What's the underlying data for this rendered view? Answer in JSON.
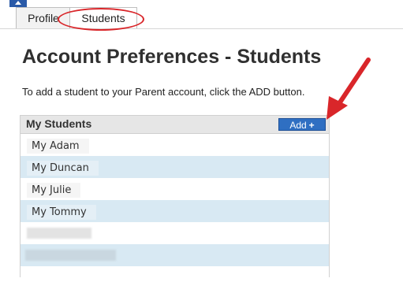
{
  "tabs": [
    {
      "label": "Profile"
    },
    {
      "label": "Students"
    }
  ],
  "page": {
    "title": "Account Preferences - Students",
    "instruction": "To add a student to your Parent account, click the ADD button."
  },
  "panel": {
    "title": "My Students",
    "add_label": "Add",
    "add_icon": "plus-icon"
  },
  "students": [
    {
      "name": "My Adam"
    },
    {
      "name": "My Duncan"
    },
    {
      "name": "My Julie"
    },
    {
      "name": "My Tommy"
    }
  ],
  "colors": {
    "accent": "#2f6fc2",
    "row_alt": "#d8e9f3",
    "annotation": "#d9262a"
  }
}
